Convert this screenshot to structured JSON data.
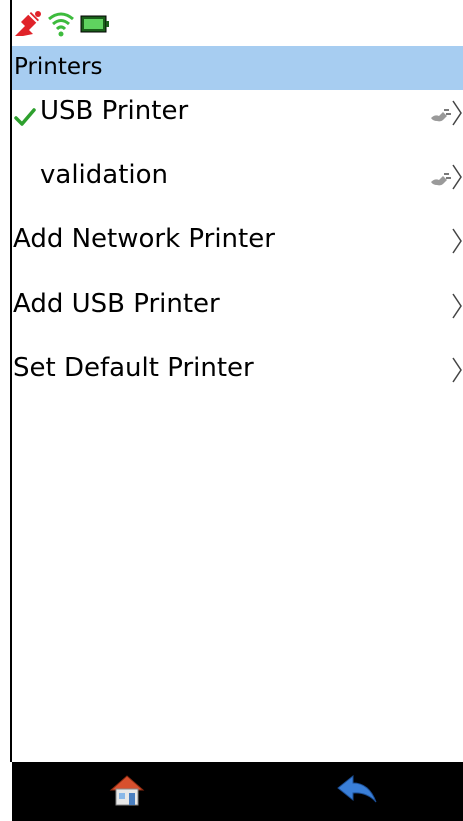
{
  "status_bar": {
    "icons": [
      "signal-off-icon",
      "wifi-icon",
      "battery-icon"
    ],
    "colors": {
      "signal": "#e0232a",
      "wifi": "#3dbb3d",
      "battery": "#3aa53a"
    }
  },
  "header": {
    "title": "Printers",
    "background": "#a7cdf1"
  },
  "list": {
    "items": [
      {
        "label": "USB Printer",
        "checked": true,
        "connected_icon": "plug-icon",
        "chevron": true
      },
      {
        "label": "validation",
        "checked": false,
        "connected_icon": "plug-icon",
        "chevron": true
      },
      {
        "label": "Add Network Printer",
        "checked": false,
        "connected_icon": null,
        "chevron": true
      },
      {
        "label": "Add USB Printer",
        "checked": false,
        "connected_icon": null,
        "chevron": true
      },
      {
        "label": "Set Default Printer",
        "checked": false,
        "connected_icon": null,
        "chevron": true
      }
    ]
  },
  "bottom_nav": {
    "buttons": [
      "home-icon",
      "back-icon"
    ]
  }
}
